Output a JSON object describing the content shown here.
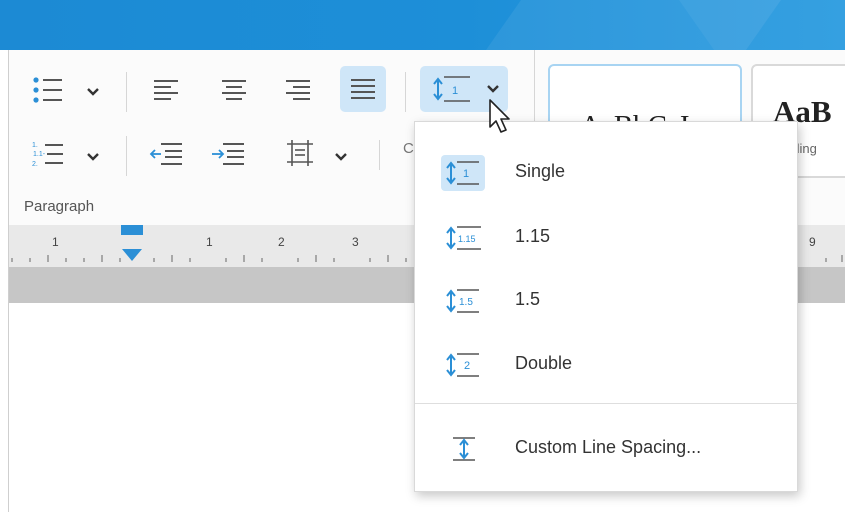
{
  "ribbon": {
    "group_label": "Paragraph",
    "partial_letter": "C",
    "styles": [
      {
        "sample": "AaBbCcI",
        "name": ""
      },
      {
        "sample": "AaB",
        "name": "ading"
      }
    ]
  },
  "ruler": {
    "numbers": [
      "1",
      "1",
      "2",
      "3",
      "9"
    ]
  },
  "line_spacing_menu": {
    "items": [
      {
        "label": "Single",
        "icon": "line-spacing-single-icon",
        "badge": "1",
        "selected": true
      },
      {
        "label": "1.15",
        "icon": "line-spacing-1-15-icon",
        "badge": "1.15",
        "selected": false
      },
      {
        "label": "1.5",
        "icon": "line-spacing-1-5-icon",
        "badge": "1.5",
        "selected": false
      },
      {
        "label": "Double",
        "icon": "line-spacing-double-icon",
        "badge": "2",
        "selected": false
      }
    ],
    "custom_label": "Custom Line Spacing..."
  },
  "colors": {
    "accent": "#1d8ad5",
    "icon_blue": "#2b8fd6",
    "selected_bg": "#cfe6f8"
  }
}
